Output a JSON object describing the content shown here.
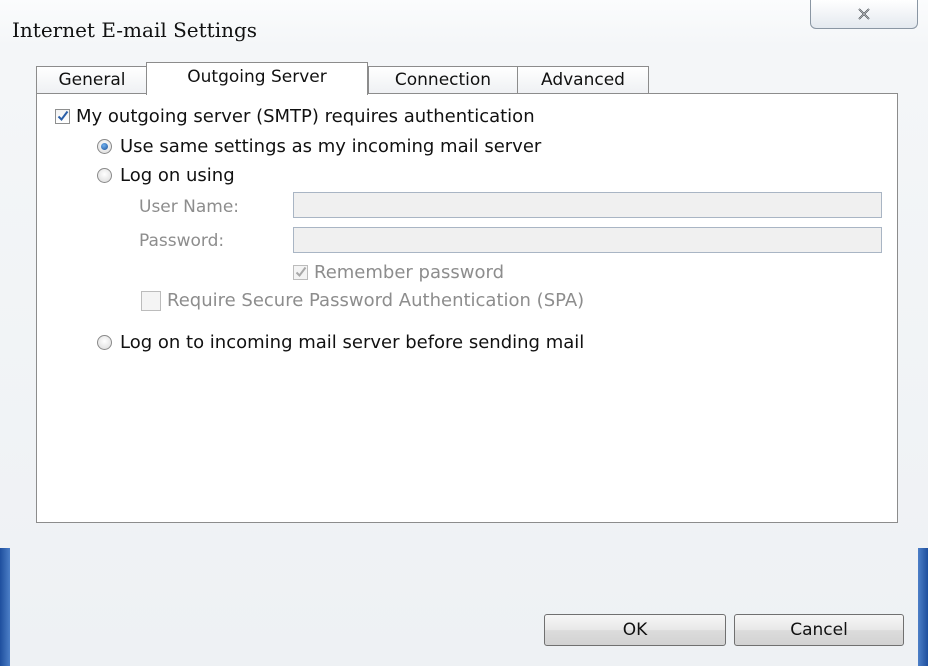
{
  "window": {
    "title": "Internet E-mail Settings",
    "close_icon": "close-x-icon"
  },
  "tabs": [
    {
      "label": "General",
      "active": false
    },
    {
      "label": "Outgoing Server",
      "active": true
    },
    {
      "label": "Connection",
      "active": false
    },
    {
      "label": "Advanced",
      "active": false
    }
  ],
  "outgoing": {
    "requires_auth_label": "My outgoing server (SMTP) requires authentication",
    "requires_auth_checked": true,
    "same_settings_label": "Use same settings as my incoming mail server",
    "same_settings_selected": true,
    "log_on_using_label": "Log on using",
    "username_label": "User Name:",
    "username_value": "",
    "password_label": "Password:",
    "password_value": "",
    "remember_password_label": "Remember password",
    "remember_password_checked": true,
    "spa_label": "Require Secure Password Authentication (SPA)",
    "spa_checked": false,
    "log_on_incoming_label": "Log on to incoming mail server before sending mail"
  },
  "buttons": {
    "ok_label": "OK",
    "cancel_label": "Cancel"
  },
  "colors": {
    "accent_blue": "#1e4f9e",
    "radio_dot": "#1b4f96",
    "check_mark": "#2b5fa8"
  }
}
